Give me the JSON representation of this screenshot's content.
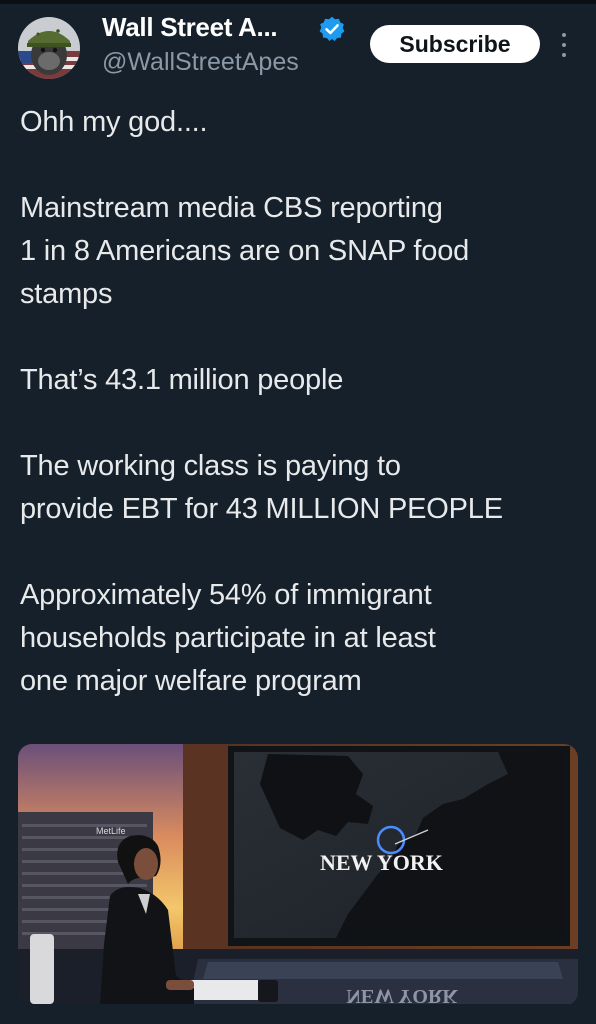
{
  "author": {
    "display_name": "Wall Street A...",
    "handle": "@WallStreetApes",
    "verified": true,
    "avatar_icon": "gorilla-soldier-avatar",
    "badge_icon": "verified-badge-icon",
    "badge_color": "#1d9bf0"
  },
  "actions": {
    "subscribe_label": "Subscribe",
    "more_icon": "more-vertical-icon"
  },
  "tweet": {
    "paragraphs": [
      [
        "Ohh my god...."
      ],
      [
        "Mainstream media CBS reporting",
        "1 in 8 Americans are on SNAP food",
        "stamps"
      ],
      [
        "That’s 43.1 million people"
      ],
      [
        "The working class is paying to",
        "provide EBT for 43 MILLION PEOPLE"
      ],
      [
        "Approximately 54% of immigrant",
        "households participate in at least",
        "one major welfare program"
      ]
    ]
  },
  "media": {
    "map_label": "NEW YORK",
    "desk_text": "NEW YORK",
    "building_sign": "MetLife"
  },
  "colors": {
    "background": "#15202b",
    "text": "#e7e9ea",
    "secondary": "#8b98a5",
    "accent": "#1d9bf0"
  }
}
